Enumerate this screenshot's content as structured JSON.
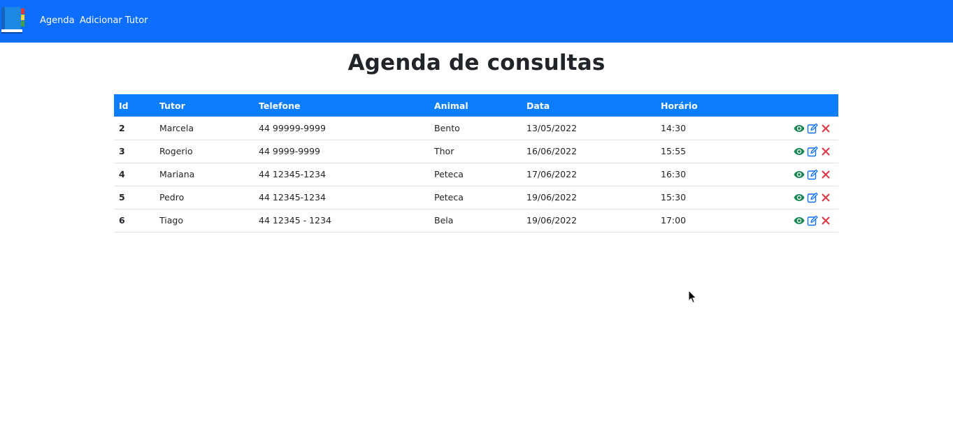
{
  "nav": {
    "links": [
      "Agenda",
      "Adicionar Tutor"
    ],
    "brand_icon": "agenda-book-icon"
  },
  "page": {
    "title": "Agenda de consultas"
  },
  "table": {
    "headers": [
      "Id",
      "Tutor",
      "Telefone",
      "Animal",
      "Data",
      "Horário",
      ""
    ],
    "rows": [
      {
        "id": "2",
        "tutor": "Marcela",
        "telefone": "44 99999-9999",
        "animal": "Bento",
        "data": "13/05/2022",
        "horario": "14:30"
      },
      {
        "id": "3",
        "tutor": "Rogerio",
        "telefone": "44 9999-9999",
        "animal": "Thor",
        "data": "16/06/2022",
        "horario": "15:55"
      },
      {
        "id": "4",
        "tutor": "Mariana",
        "telefone": "44 12345-1234",
        "animal": "Peteca",
        "data": "17/06/2022",
        "horario": "16:30"
      },
      {
        "id": "5",
        "tutor": "Pedro",
        "telefone": "44 12345-1234",
        "animal": "Peteca",
        "data": "19/06/2022",
        "horario": "15:30"
      },
      {
        "id": "6",
        "tutor": "Tiago",
        "telefone": "44 12345 - 1234",
        "animal": "Bela",
        "data": "19/06/2022",
        "horario": "17:00"
      }
    ],
    "row_actions": [
      "eye-icon",
      "edit-icon",
      "close-icon"
    ]
  },
  "colors": {
    "navbar": "#0d6efd",
    "table_header": "#0d7efb",
    "view": "#198754",
    "edit": "#0d6efd",
    "delete": "#dc3545"
  }
}
